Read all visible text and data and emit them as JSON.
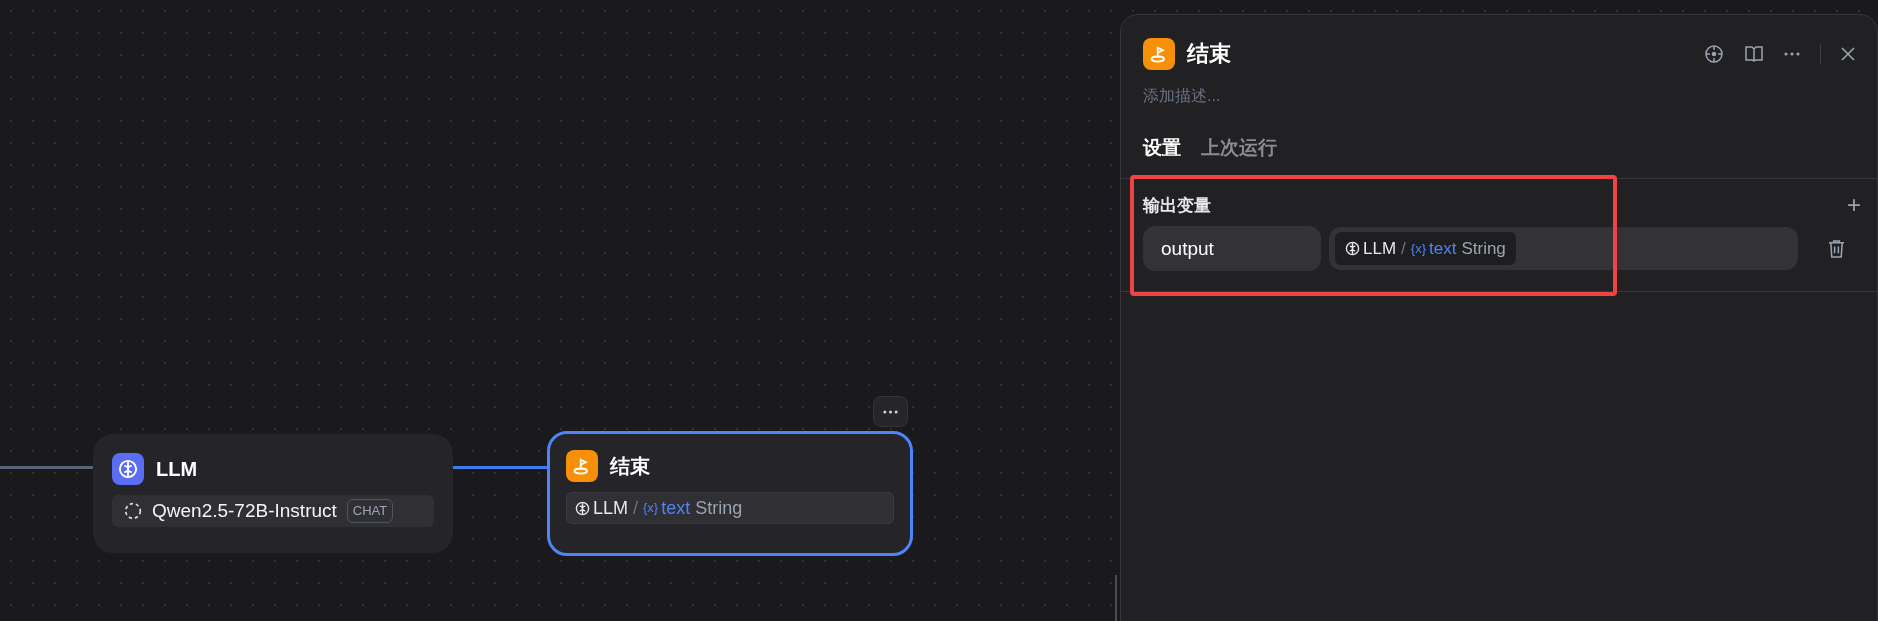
{
  "canvas": {
    "nodes": [
      {
        "kind": "llm",
        "title": "LLM",
        "model": "Qwen2.5-72B-Instruct",
        "model_tag": "CHAT",
        "selected": false
      },
      {
        "kind": "end",
        "title": "结束",
        "source": "LLM",
        "separator": "/",
        "variable_icon": "{x}",
        "variable": "text",
        "type": "String",
        "selected": true
      }
    ]
  },
  "panel": {
    "title": "结束",
    "description_placeholder": "添加描述...",
    "tabs": [
      {
        "label": "设置",
        "selected": true
      },
      {
        "label": "上次运行",
        "selected": false
      }
    ],
    "section_title": "输出变量",
    "add_icon": "+",
    "outputs": [
      {
        "name": "output",
        "source": "LLM",
        "separator": "/",
        "variable_icon": "{x}",
        "variable": "text",
        "type": "String"
      }
    ],
    "highlighted": true
  }
}
